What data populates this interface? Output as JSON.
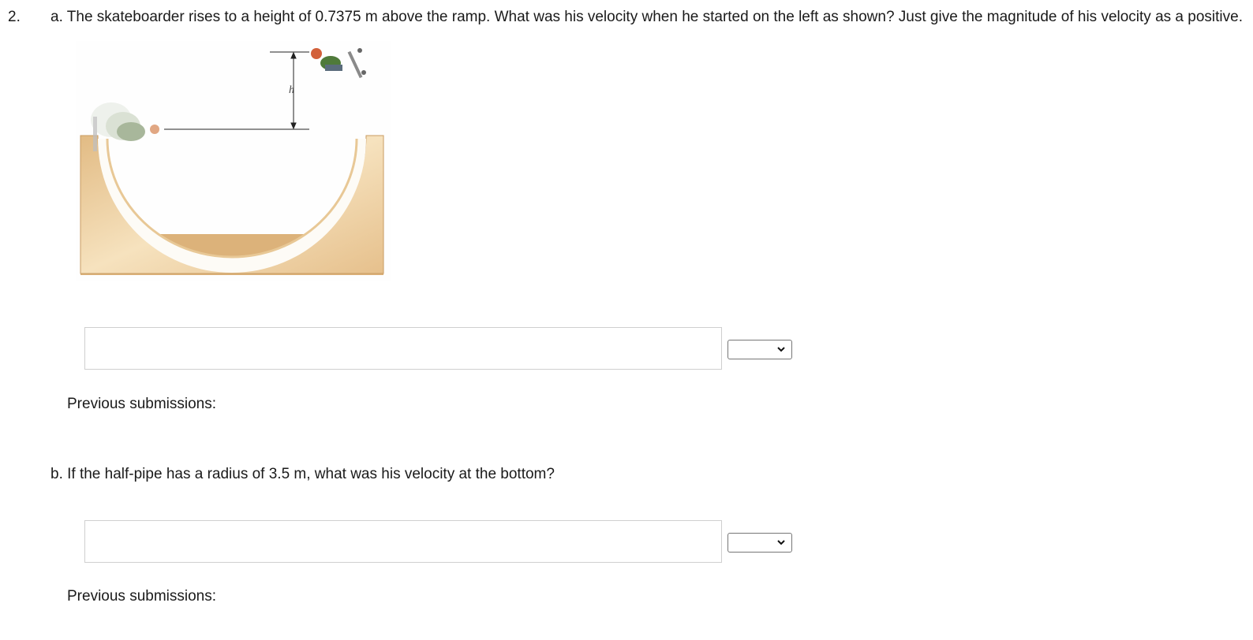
{
  "question": {
    "number": "2.",
    "part_a": {
      "prompt": "a. The skateboarder rises to a height of 0.7375 m above the ramp. What was his velocity when he started on the left as shown? Just give the magnitude of his velocity as a positive.",
      "figure_label": "h",
      "answer": {
        "value": "",
        "placeholder": ""
      },
      "unit_select": {
        "selected": ""
      },
      "previous_submissions_label": "Previous submissions:"
    },
    "part_b": {
      "prompt": "b. If the half-pipe has a radius of 3.5 m, what was his velocity at the bottom?",
      "answer": {
        "value": "",
        "placeholder": ""
      },
      "unit_select": {
        "selected": ""
      },
      "previous_submissions_label": "Previous submissions:"
    }
  },
  "colors": {
    "ramp_wood": "#e7c48f",
    "ramp_frame": "#d9ae76",
    "input_border": "#cfcfcf",
    "text": "#1a1a1a"
  },
  "icons": {
    "select_arrow": "chevron-down-icon"
  }
}
